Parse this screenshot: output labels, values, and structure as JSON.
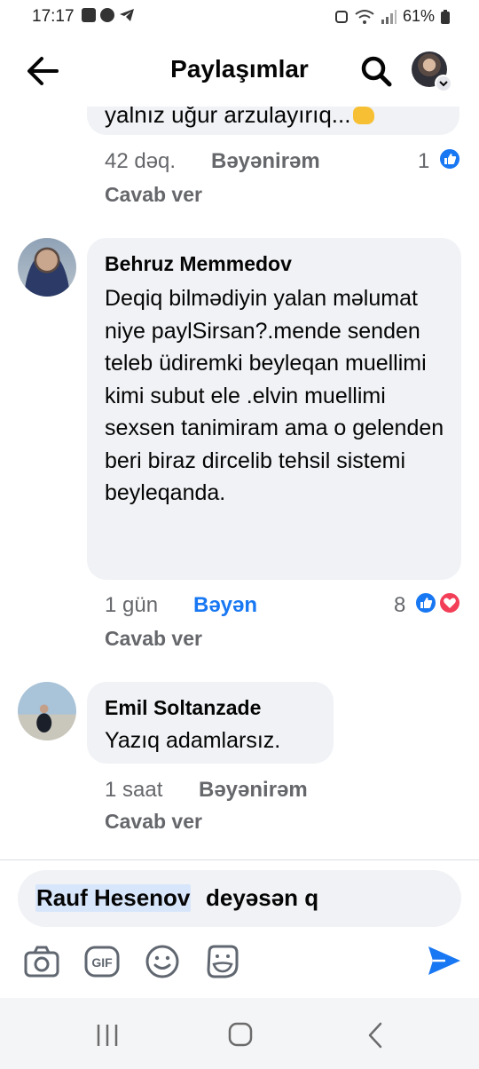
{
  "status_bar": {
    "time": "17:17",
    "battery": "61%"
  },
  "header": {
    "title": "Paylaşımlar"
  },
  "comments": [
    {
      "text": "yalnız uğur arzulayırıq...",
      "time": "42 dəq.",
      "like_label": "Bəyənirəm",
      "reply_label": "Cavab ver",
      "reaction_count": "1"
    },
    {
      "author": "Behruz Memmedov",
      "text": "Deqiq bilmədiyin yalan məlumat niye paylSirsan?.mende senden teleb üdiremki beyleqan muellimi kimi subut ele .elvin muellimi sexsen tanimiram ama o gelenden beri biraz dircelib tehsil sistemi beyleqanda.",
      "time": "1 gün",
      "like_label": "Bəyən",
      "reply_label": "Cavab ver",
      "reaction_count": "8"
    },
    {
      "author": "Emil Soltanzade",
      "text": "Yazıq adamlarsız.",
      "time": "1 saat",
      "like_label": "Bəyənirəm",
      "reply_label": "Cavab ver"
    }
  ],
  "composer": {
    "mention": "Rauf Hesenov",
    "typed_text": "deyəsən q"
  },
  "colors": {
    "accent": "#1877f2",
    "love": "#f33e58",
    "bubble": "#f0f2f5",
    "meta": "#65676b"
  },
  "icons": {
    "header": [
      "back-arrow-icon",
      "search-icon",
      "profile-avatar"
    ],
    "composer_tools": [
      "camera-icon",
      "gif-icon",
      "emoji-icon",
      "sticker-icon",
      "send-icon"
    ],
    "nav": [
      "recent-apps-icon",
      "home-icon",
      "back-icon"
    ]
  }
}
